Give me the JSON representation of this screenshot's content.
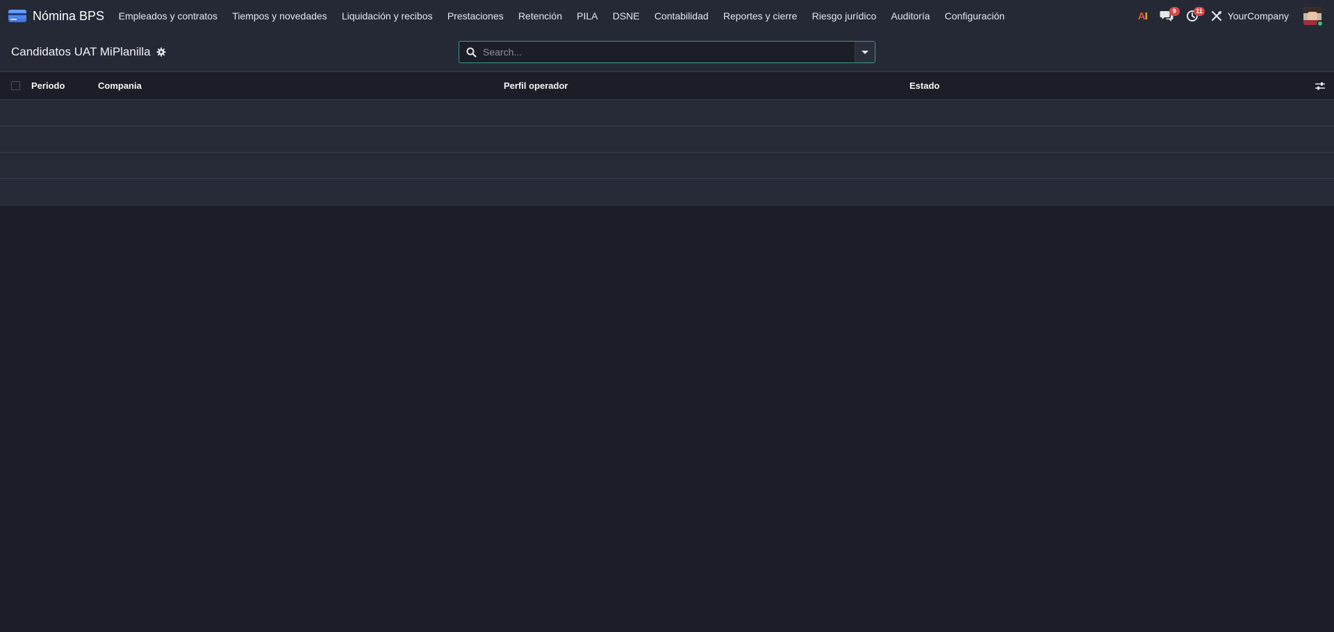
{
  "navbar": {
    "app_name": "Nómina BPS",
    "menu": [
      {
        "label": "Empleados y contratos"
      },
      {
        "label": "Tiempos y novedades"
      },
      {
        "label": "Liquidación y recibos"
      },
      {
        "label": "Prestaciones"
      },
      {
        "label": "Retención"
      },
      {
        "label": "PILA"
      },
      {
        "label": "DSNE"
      },
      {
        "label": "Contabilidad"
      },
      {
        "label": "Reportes y cierre"
      },
      {
        "label": "Riesgo jurídico"
      },
      {
        "label": "Auditoría"
      },
      {
        "label": "Configuración"
      }
    ],
    "systray": {
      "ai_label_a": "A",
      "ai_label_i": "I",
      "messages_count": "9",
      "activities_count": "11",
      "company": "YourCompany"
    }
  },
  "control_panel": {
    "title": "Candidatos UAT MiPlanilla",
    "search": {
      "placeholder": "Search..."
    }
  },
  "list": {
    "columns": [
      {
        "label": "Periodo"
      },
      {
        "label": "Compania"
      },
      {
        "label": "Perfil operador"
      },
      {
        "label": "Estado"
      }
    ],
    "empty_rows": 4
  },
  "colors": {
    "background": "#1b1e26",
    "navbar": "#252936",
    "row": "#262a36",
    "search_border": "#3f9b8e",
    "badge": "#d44a4a",
    "online": "#2ecc71"
  }
}
